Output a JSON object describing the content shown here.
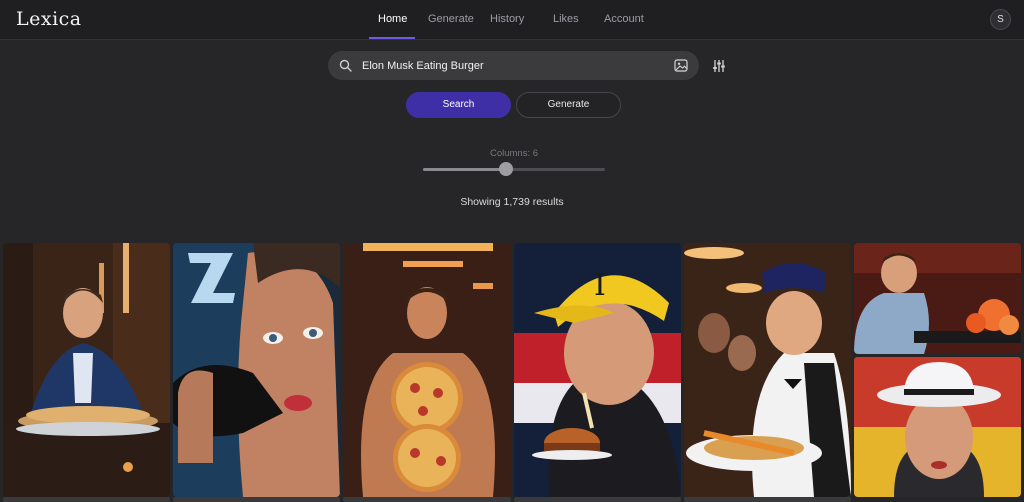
{
  "app": {
    "logo_text": "Lexica",
    "avatar_initial": "S"
  },
  "nav": {
    "items": [
      {
        "label": "Home",
        "active": true
      },
      {
        "label": "Generate",
        "active": false
      },
      {
        "label": "History",
        "active": false
      },
      {
        "label": "Likes",
        "active": false
      },
      {
        "label": "Account",
        "active": false
      }
    ]
  },
  "search": {
    "query": "Elon Musk Eating Burger",
    "search_button": "Search",
    "generate_button": "Generate",
    "icons": [
      "search-icon",
      "image-search-icon",
      "filter-sliders-icon"
    ]
  },
  "columns": {
    "label": "Columns:",
    "value": 6,
    "min": 1,
    "max": 12
  },
  "results": {
    "summary": "Showing 1,739 results"
  },
  "gallery": {
    "image_count_visible": 7
  },
  "colors": {
    "accent": "#6d5ce6",
    "search_button": "#3f2fa6",
    "background": "#262628"
  }
}
